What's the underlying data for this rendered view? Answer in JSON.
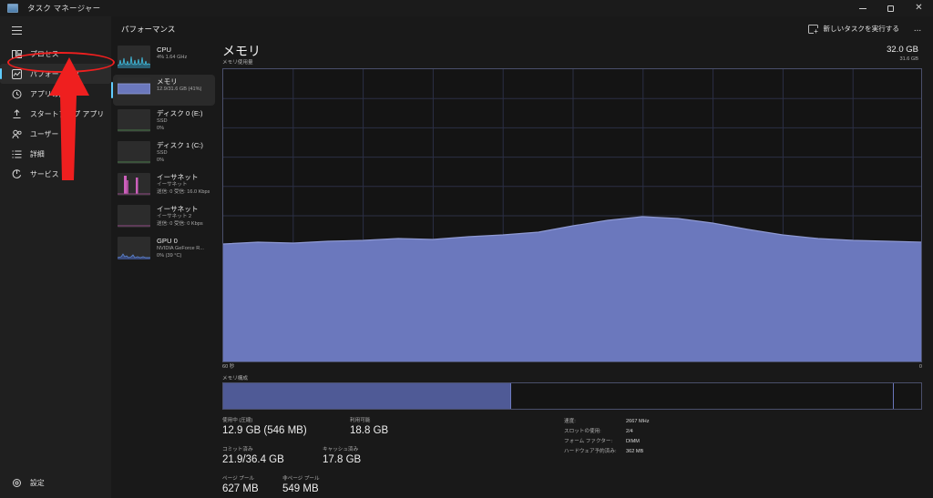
{
  "window": {
    "title": "タスク マネージャー",
    "icon": "taskmanager-icon",
    "controls": {
      "minimize": "minimize-icon",
      "maximize": "maximize-icon",
      "close": "close-icon"
    }
  },
  "sidebar": {
    "menu_icon": "hamburger-icon",
    "items": [
      {
        "label": "プロセス",
        "icon": "processes-icon",
        "selected": false
      },
      {
        "label": "パフォーマンス",
        "icon": "performance-icon",
        "selected": true
      },
      {
        "label": "アプリの履歴",
        "icon": "app-history-icon",
        "selected": false
      },
      {
        "label": "スタートアップ アプリ",
        "icon": "startup-apps-icon",
        "selected": false
      },
      {
        "label": "ユーザー",
        "icon": "users-icon",
        "selected": false
      },
      {
        "label": "詳細",
        "icon": "details-icon",
        "selected": false
      },
      {
        "label": "サービス",
        "icon": "services-icon",
        "selected": false
      }
    ],
    "settings": {
      "label": "設定",
      "icon": "gear-icon"
    }
  },
  "commandbar": {
    "title": "パフォーマンス",
    "new_task_label": "新しいタスクを実行する",
    "new_task_icon": "new-task-icon",
    "more_label": "...",
    "more_icon": "more-options-icon"
  },
  "resources": [
    {
      "name": "CPU",
      "lines": [
        "4%  1.64 GHz"
      ],
      "selected": false,
      "thumb": "cpu-sparkline",
      "color": "#3fa9c9"
    },
    {
      "name": "メモリ",
      "lines": [
        "12.9/31.6 GB (41%)"
      ],
      "selected": true,
      "thumb": "memory-bar",
      "color": "#6b78bd"
    },
    {
      "name": "ディスク 0 (E:)",
      "lines": [
        "SSD",
        "0%"
      ],
      "selected": false,
      "thumb": "disk-flat",
      "color": "#5a9e5a"
    },
    {
      "name": "ディスク 1 (C:)",
      "lines": [
        "SSD",
        "0%"
      ],
      "selected": false,
      "thumb": "disk-flat",
      "color": "#5a9e5a"
    },
    {
      "name": "イーサネット",
      "lines": [
        "イーサネット",
        "送信: 0 受信: 16.0 Kbps"
      ],
      "selected": false,
      "thumb": "ethernet-spikes",
      "color": "#e06bd0"
    },
    {
      "name": "イーサネット",
      "lines": [
        "イーサネット 2",
        "送信: 0 受信: 0 Kbps"
      ],
      "selected": false,
      "thumb": "ethernet-flat",
      "color": "#e06bd0"
    },
    {
      "name": "GPU 0",
      "lines": [
        "NVIDIA GeForce R...",
        "0%  (39 °C)"
      ],
      "selected": false,
      "thumb": "gpu-sparkline",
      "color": "#5b7fc4"
    }
  ],
  "main": {
    "title": "メモリ",
    "subtitle": "メモリ使用量",
    "total": "32.0 GB",
    "scale_max": "31.6 GB",
    "axis_left": "60 秒",
    "axis_right": "0",
    "composition_label": "メモリ構成",
    "stats": [
      {
        "caption": "使用中 (圧縮)",
        "value": "12.9 GB (546 MB)"
      },
      {
        "caption": "利用可能",
        "value": "18.8 GB"
      },
      {
        "caption": "コミット済み",
        "value": "21.9/36.4 GB"
      },
      {
        "caption": "キャッシュ済み",
        "value": "17.8 GB"
      },
      {
        "caption": "ページ プール",
        "value": "627 MB"
      },
      {
        "caption": "非ページ プール",
        "value": "549 MB"
      }
    ],
    "specs": [
      {
        "key": "速度:",
        "value": "2667 MHz"
      },
      {
        "key": "スロットの使用:",
        "value": "2/4"
      },
      {
        "key": "フォーム ファクター:",
        "value": "DIMM"
      },
      {
        "key": "ハードウェア予約済み:",
        "value": "362 MB"
      }
    ]
  },
  "annotations": {
    "highlight_ellipse": "red-ellipse-performance",
    "arrow": "red-arrow-pointing-up"
  },
  "chart_data": {
    "type": "area",
    "title": "メモリ使用量",
    "ylabel": "メモリ",
    "xlabel": "60 秒",
    "ylim": [
      0,
      31.6
    ],
    "xlim": [
      60,
      0
    ],
    "grid": true,
    "fill_color": "#6b78bd",
    "line_color": "#8f9ad4",
    "x": [
      60,
      57,
      54,
      51,
      48,
      45,
      42,
      39,
      36,
      33,
      30,
      27,
      24,
      21,
      18,
      15,
      12,
      9,
      6,
      3,
      0
    ],
    "values": [
      12.82,
      12.84,
      12.83,
      12.85,
      12.86,
      12.88,
      12.87,
      12.9,
      12.92,
      12.95,
      13.02,
      13.08,
      13.12,
      13.1,
      13.05,
      12.98,
      12.92,
      12.88,
      12.86,
      12.85,
      12.84
    ],
    "composition": {
      "type": "bar",
      "categories": [
        "使用中",
        "利用可能",
        "予約"
      ],
      "values": [
        41.0,
        57.2,
        1.8
      ]
    }
  }
}
